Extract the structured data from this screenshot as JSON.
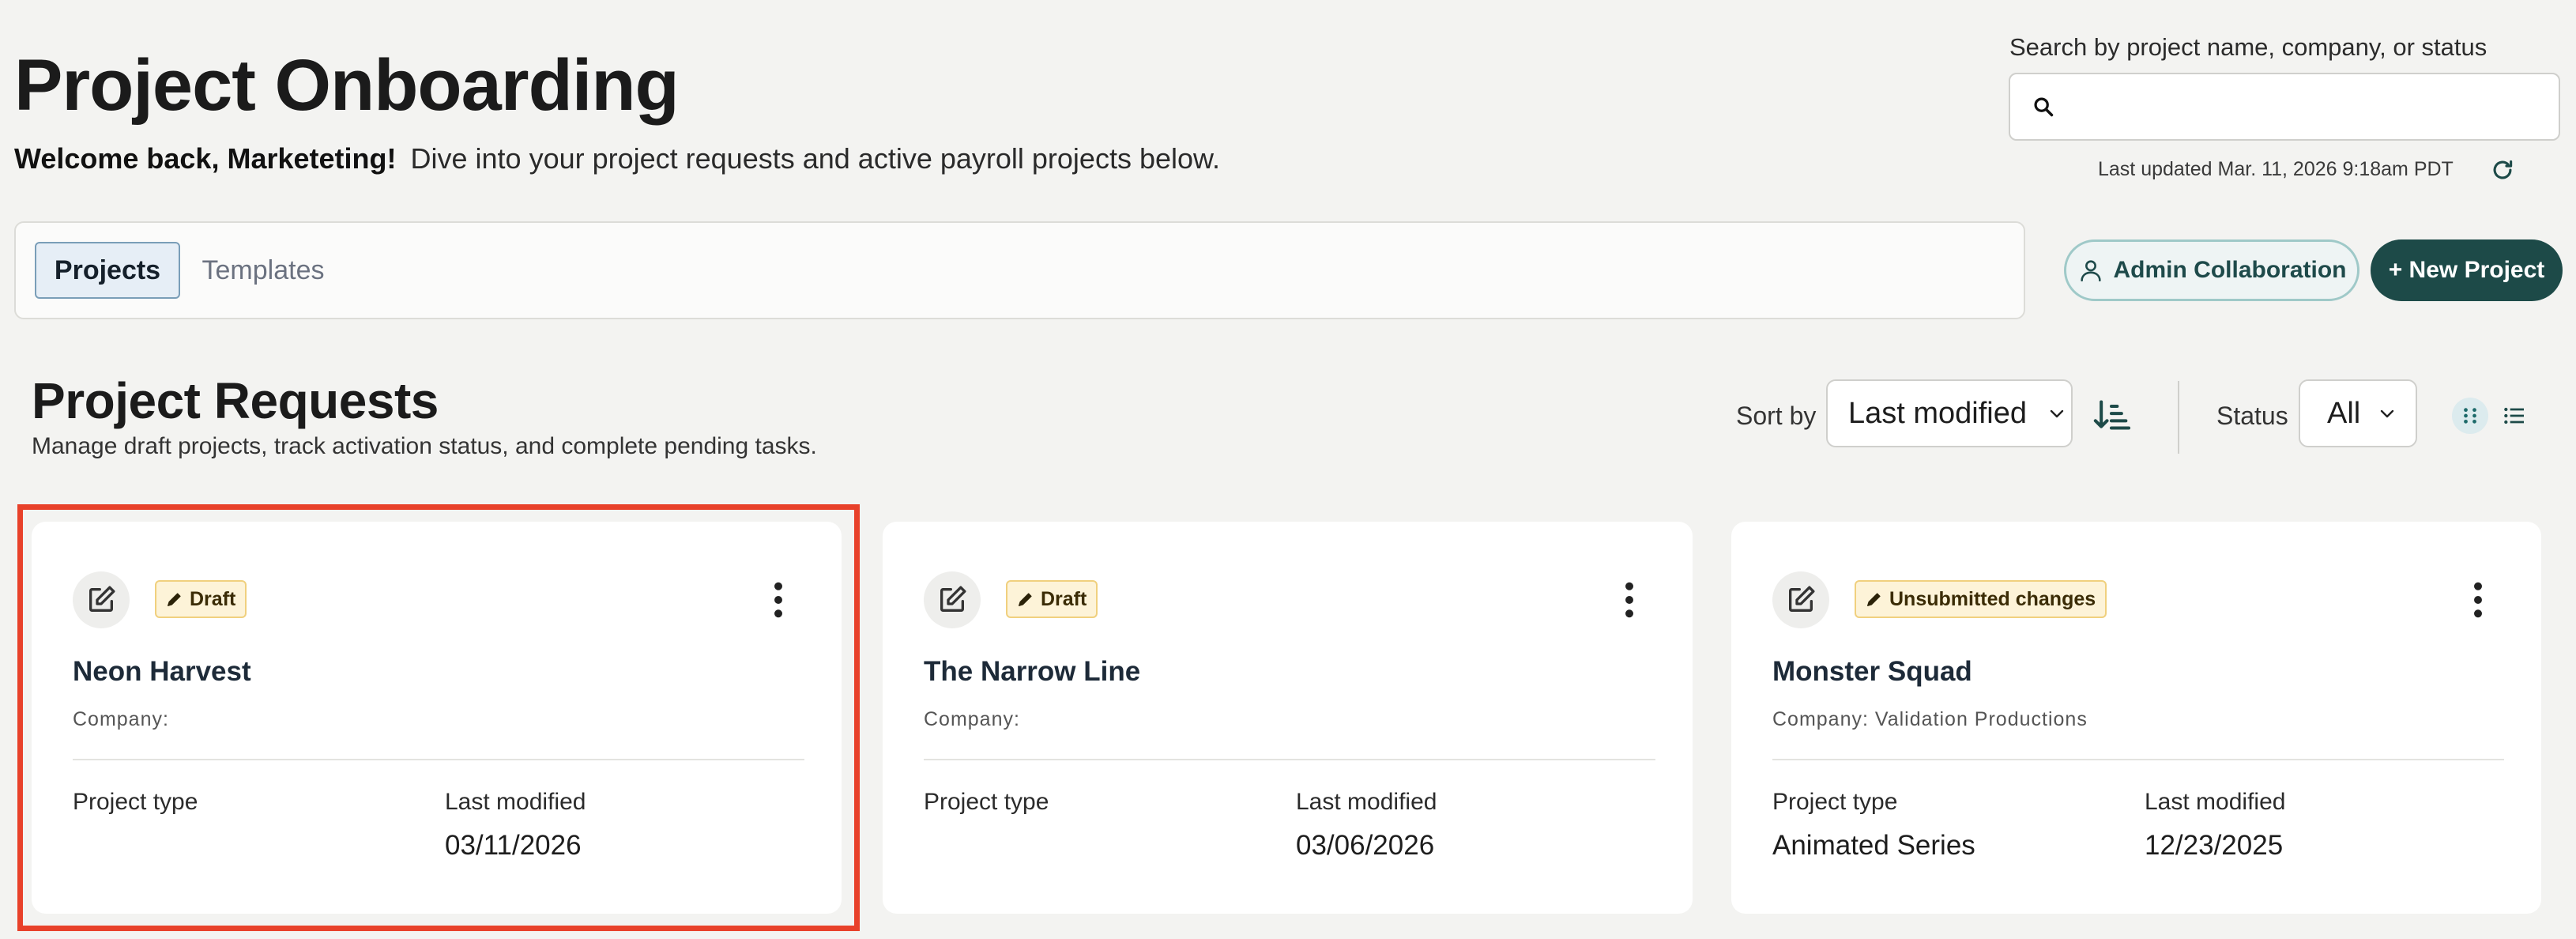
{
  "header": {
    "title": "Project Onboarding",
    "welcome_bold": "Welcome back, Marketeting!",
    "welcome_text": "Dive into your project requests and active payroll projects below."
  },
  "search": {
    "label": "Search by project name, company, or status",
    "value": "",
    "icon": "search-icon"
  },
  "last_updated": "Last updated Mar. 11, 2026 9:18am PDT",
  "tabs": [
    {
      "label": "Projects",
      "active": true
    },
    {
      "label": "Templates",
      "active": false
    }
  ],
  "actions": {
    "admin_label": "Admin Collaboration",
    "new_label": "+ New Project"
  },
  "section": {
    "title": "Project Requests",
    "subtitle": "Manage draft projects, track activation status, and complete pending tasks."
  },
  "filters": {
    "sort_label": "Sort by",
    "sort_value": "Last modified",
    "status_label": "Status",
    "status_value": "All"
  },
  "labels": {
    "project_type": "Project type",
    "last_modified": "Last modified",
    "company_prefix": "Company:"
  },
  "cards": [
    {
      "badge": "Draft",
      "name": "Neon Harvest",
      "company": "",
      "project_type": "",
      "last_modified": "03/11/2026",
      "highlighted": true
    },
    {
      "badge": "Draft",
      "name": "The Narrow Line",
      "company": "",
      "project_type": "",
      "last_modified": "03/06/2026",
      "highlighted": false
    },
    {
      "badge": "Unsubmitted changes",
      "name": "Monster Squad",
      "company": "Validation Productions",
      "project_type": "Animated Series",
      "last_modified": "12/23/2025",
      "highlighted": false
    }
  ],
  "colors": {
    "background": "#f3f3f1",
    "primary": "#1d4a48",
    "accent_border": "#9fc9c8",
    "badge_bg": "#fdf3d8",
    "highlight": "#e8412a"
  }
}
